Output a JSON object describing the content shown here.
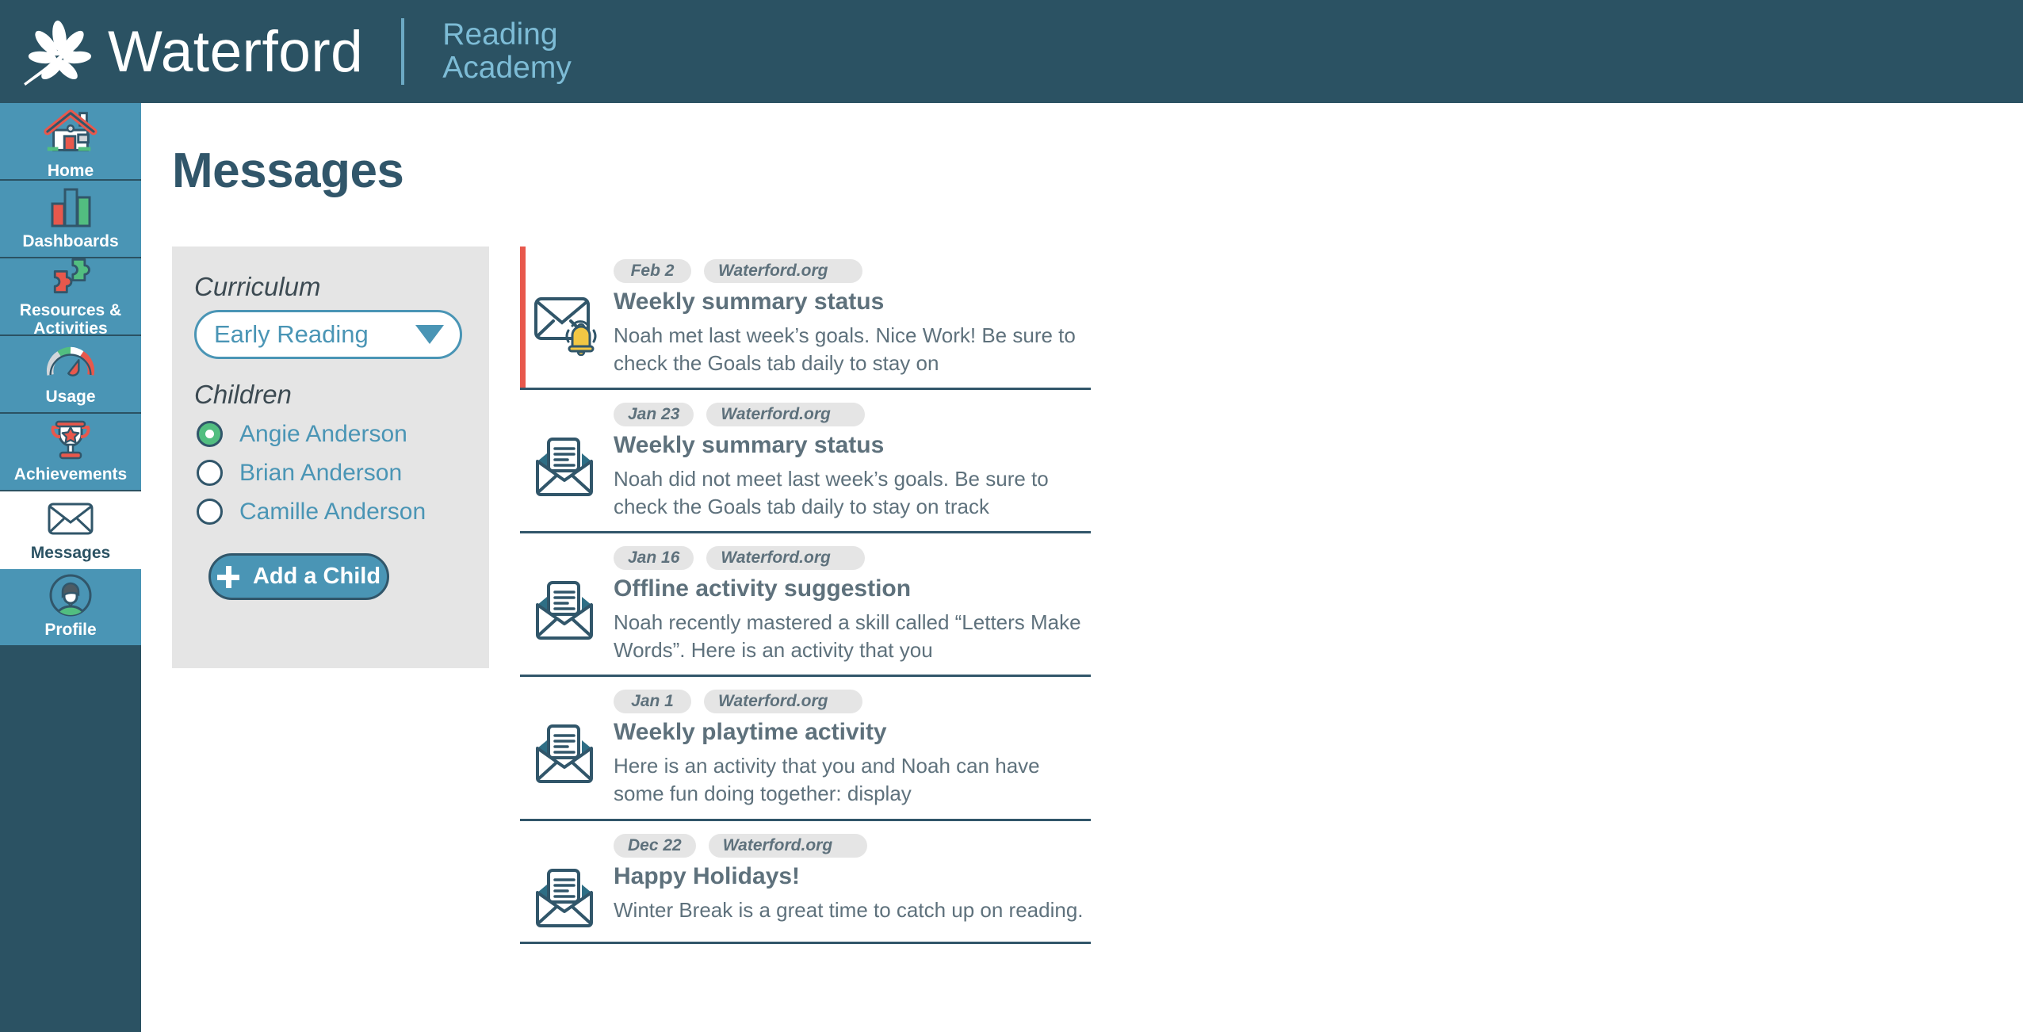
{
  "header": {
    "brand_name": "Waterford",
    "product_name": "Reading\nAcademy",
    "logo_icon": "flower-starburst-logo"
  },
  "sidebar": {
    "items": [
      {
        "id": "home",
        "label": "Home",
        "icon": "house-icon",
        "active": false
      },
      {
        "id": "dashboards",
        "label": "Dashboards",
        "icon": "bar-chart-icon",
        "active": false
      },
      {
        "id": "resources",
        "label": "Resources &\nActivities",
        "icon": "puzzle-pieces-icon",
        "active": false
      },
      {
        "id": "usage",
        "label": "Usage",
        "icon": "gauge-icon",
        "active": false
      },
      {
        "id": "achievements",
        "label": "Achievements",
        "icon": "trophy-icon",
        "active": false
      },
      {
        "id": "messages",
        "label": "Messages",
        "icon": "envelope-icon",
        "active": true
      },
      {
        "id": "profile",
        "label": "Profile",
        "icon": "avatar-icon",
        "active": false
      }
    ]
  },
  "main": {
    "page_title": "Messages"
  },
  "filters": {
    "curriculum_label": "Curriculum",
    "curriculum_value": "Early Reading",
    "curriculum_caret_icon": "chevron-down-icon",
    "children_label": "Children",
    "children": [
      {
        "name": "Angie Anderson",
        "selected": true
      },
      {
        "name": "Brian Anderson",
        "selected": false
      },
      {
        "name": "Camille Anderson",
        "selected": false
      }
    ],
    "add_child_label": "Add a Child",
    "add_child_icon": "plus-icon"
  },
  "messages": [
    {
      "date": "Feb 2",
      "source": "Waterford.org",
      "title": "Weekly summary status",
      "preview": "Noah met last week’s goals. Nice Work! Be sure to check the Goals tab daily to stay on",
      "unread": true,
      "icon": "closed-envelope-bell-icon"
    },
    {
      "date": "Jan 23",
      "source": "Waterford.org",
      "title": "Weekly summary status",
      "preview": "Noah did not meet last week’s goals. Be sure to check the Goals tab daily to stay on track",
      "unread": false,
      "icon": "open-envelope-icon"
    },
    {
      "date": "Jan 16",
      "source": "Waterford.org",
      "title": "Offline activity suggestion",
      "preview": "Noah recently mastered a skill called “Letters Make Words”.  Here is an activity that you",
      "unread": false,
      "icon": "open-envelope-icon"
    },
    {
      "date": "Jan 1",
      "source": "Waterford.org",
      "title": "Weekly playtime activity",
      "preview": "Here is an activity that you and Noah can have some fun doing together: display",
      "unread": false,
      "icon": "open-envelope-icon"
    },
    {
      "date": "Dec 22",
      "source": "Waterford.org",
      "title": "Happy Holidays!",
      "preview": "Winter Break is a great time to catch up on reading.",
      "unread": false,
      "icon": "open-envelope-icon"
    }
  ],
  "colors": {
    "header_bg": "#2b5263",
    "sidebar_bg": "#4a95b5",
    "accent_blue": "#4a95b5",
    "dark_teal": "#31566a",
    "unread_red": "#e8584c",
    "green": "#52be80",
    "bell_yellow": "#f2c744",
    "panel_gray": "#e5e5e5",
    "text_gray": "#5e717c"
  }
}
